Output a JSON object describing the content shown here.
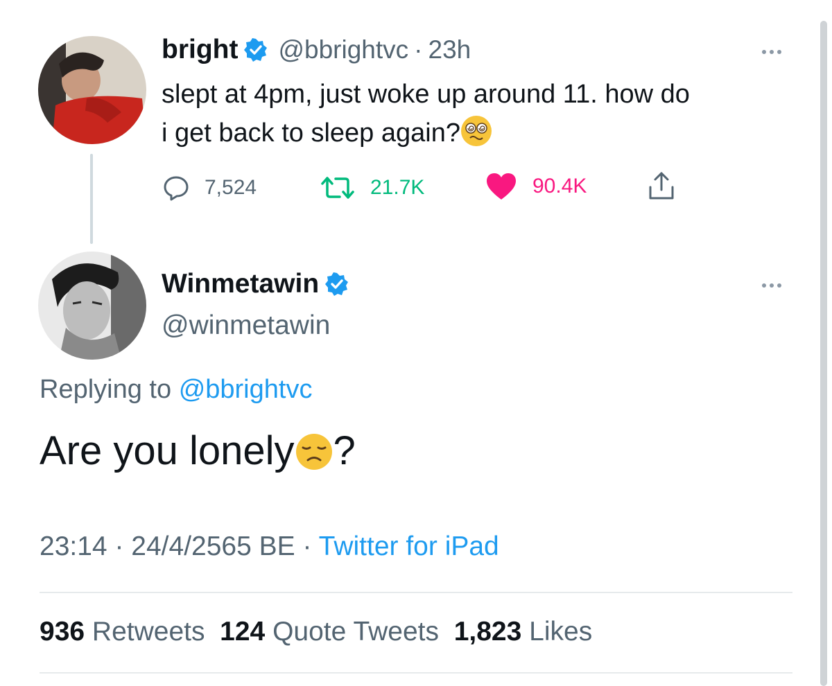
{
  "tweet": {
    "author_name": "bright",
    "handle": "@bbrightvc",
    "separator": "·",
    "time_ago": "23h",
    "text_line1": "slept at 4pm, just woke up around 11. how do",
    "text_line2": "i get back to sleep again?",
    "text_emoji": "face-with-spiral-eyes",
    "actions": {
      "reply_count": "7,524",
      "retweet_count": "21.7K",
      "like_count": "90.4K"
    }
  },
  "reply": {
    "author_name": "Winmetawin",
    "handle": "@winmetawin",
    "replying_prefix": "Replying to",
    "replying_handle": "@bbrightvc",
    "text_before": "Are you lonely",
    "text_after": "?",
    "text_emoji": "disappointed-face",
    "time": "23:14",
    "date": "24/4/2565 BE",
    "separator": "·",
    "source": "Twitter for iPad"
  },
  "stats": {
    "retweets_count": "936",
    "retweets_label": "Retweets",
    "quotes_count": "124",
    "quotes_label": "Quote Tweets",
    "likes_count": "1,823",
    "likes_label": "Likes"
  },
  "icons": {
    "verified": "verified-badge-icon",
    "reply": "reply-bubble-icon",
    "retweet": "retweet-icon",
    "like": "heart-icon",
    "share": "share-icon",
    "more": "more-dots-icon"
  },
  "colors": {
    "accent": "#1d9bf0",
    "retweet": "#00ba7c",
    "like": "#f91880",
    "secondary_text": "#536471",
    "primary_text": "#0f1419"
  }
}
